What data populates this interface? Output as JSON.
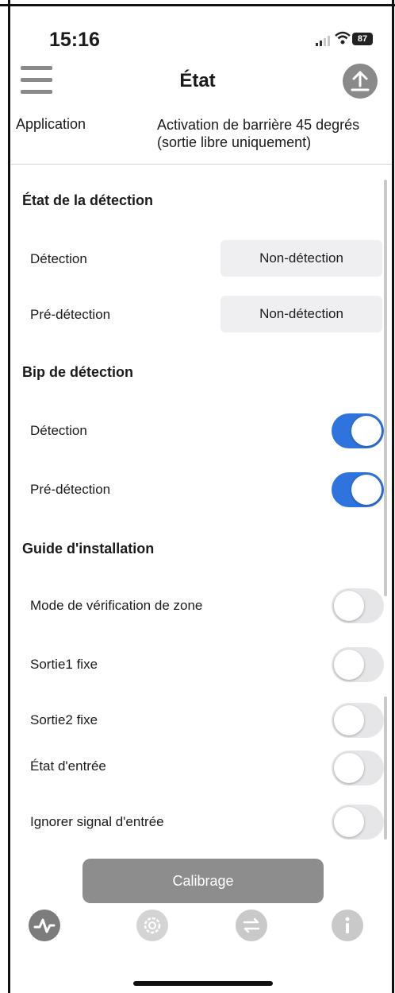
{
  "status_bar": {
    "time": "15:16",
    "battery": "87"
  },
  "header": {
    "title": "État",
    "menu_icon": "hamburger-menu-icon",
    "upload_icon": "upload-arrow-icon"
  },
  "application": {
    "label": "Application",
    "value": "Activation de barrière 45 degrés (sortie libre uniquement)"
  },
  "detection_state": {
    "title": "État de la détection",
    "rows": [
      {
        "label": "Détection",
        "value": "Non-détection"
      },
      {
        "label": "Pré-détection",
        "value": "Non-détection"
      }
    ]
  },
  "detection_beep": {
    "title": "Bip de détection",
    "rows": [
      {
        "label": "Détection",
        "on": true
      },
      {
        "label": "Pré-détection",
        "on": true
      }
    ]
  },
  "install_guide": {
    "title": "Guide d'installation",
    "rows": [
      {
        "label": "Mode de vérification de zone",
        "on": false
      },
      {
        "label": "Sortie1 fixe",
        "on": false
      },
      {
        "label": "Sortie2 fixe",
        "on": false
      },
      {
        "label": "État d'entrée",
        "on": false
      },
      {
        "label": "Ignorer signal d'entrée",
        "on": false
      }
    ]
  },
  "calibrate_button": "Calibrage",
  "tab_bar": {
    "items": [
      {
        "icon": "pulse-icon",
        "active": true
      },
      {
        "icon": "gear-icon",
        "active": false
      },
      {
        "icon": "transfer-icon",
        "active": false
      },
      {
        "icon": "info-icon",
        "active": false
      }
    ]
  },
  "colors": {
    "accent": "#2f73dd",
    "inactive_gray": "#8d8d8d"
  }
}
